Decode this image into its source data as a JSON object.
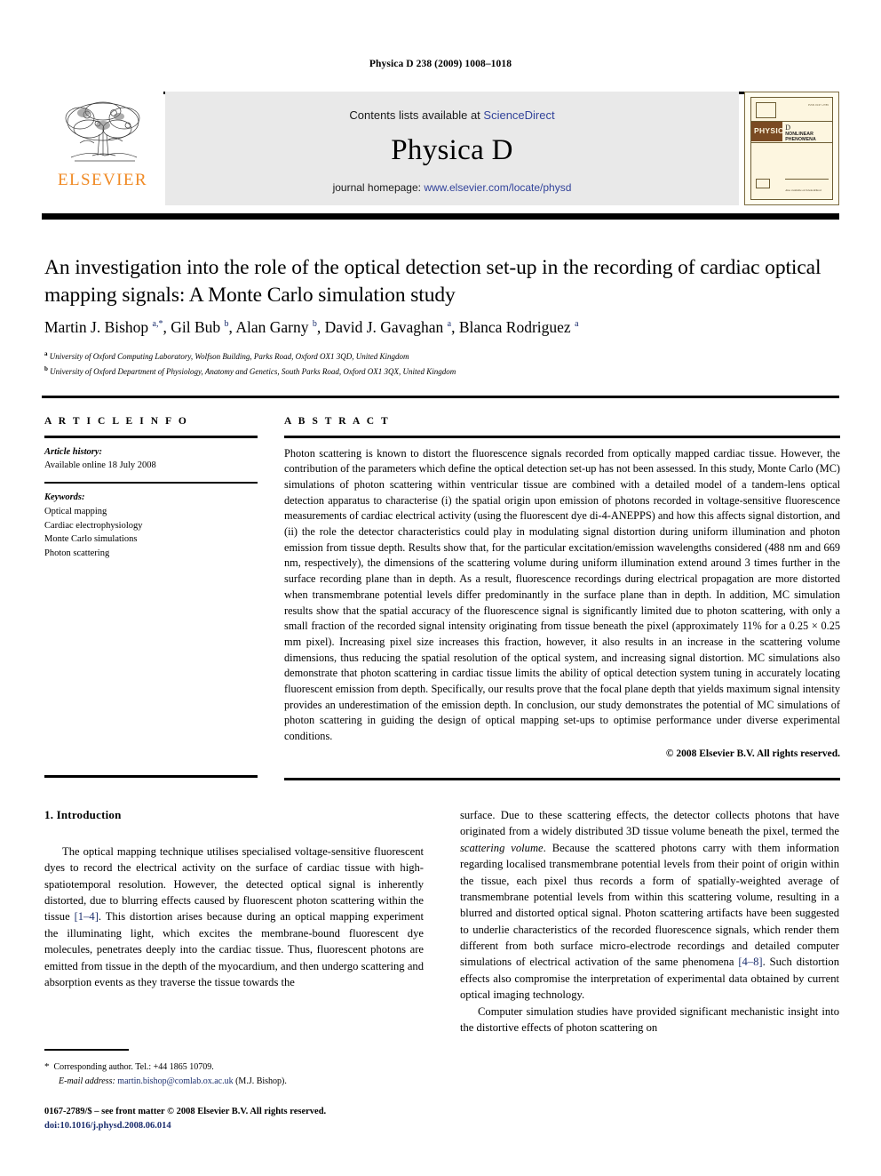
{
  "running_head": "Physica D 238 (2009) 1008–1018",
  "masthead": {
    "publisher_name": "ELSEVIER",
    "contents_prefix": "Contents lists available at ",
    "sciencedirect": "ScienceDirect",
    "journal_name": "Physica D",
    "homepage_prefix": "journal homepage: ",
    "homepage_url": "www.elsevier.com/locate/physd",
    "cover": {
      "band_title": "PHYSICA",
      "volume_letter": "D",
      "subtitle": "NONLINEAR PHENOMENA",
      "top_right": "ISSN 0167-2789",
      "foot_left": "Available online at\nScienceDirect\nwww.sciencedirect.com",
      "foot_right": "Also available on ScienceDirect"
    }
  },
  "article": {
    "title": "An investigation into the role of the optical detection set-up in the recording of cardiac optical mapping signals: A Monte Carlo simulation study",
    "authors_html": "Martin J. Bishop <sup>a,*</sup>, Gil Bub <sup>b</sup>, Alan Garny <sup>b</sup>, David J. Gavaghan <sup>a</sup>, Blanca Rodriguez <sup>a</sup>",
    "affiliation_a": "University of Oxford Computing Laboratory, Wolfson Building, Parks Road, Oxford OX1 3QD, United Kingdom",
    "affiliation_b": "University of Oxford Department of Physiology, Anatomy and Genetics, South Parks Road, Oxford OX1 3QX, United Kingdom"
  },
  "info": {
    "heading": "A R T I C L E   I N F O",
    "history_label": "Article history:",
    "history_value": "Available online 18 July 2008",
    "keywords_label": "Keywords:",
    "keywords": [
      "Optical mapping",
      "Cardiac electrophysiology",
      "Monte Carlo simulations",
      "Photon scattering"
    ]
  },
  "abstract": {
    "heading": "A B S T R A C T",
    "text": "Photon scattering is known to distort the fluorescence signals recorded from optically mapped cardiac tissue. However, the contribution of the parameters which define the optical detection set-up has not been assessed. In this study, Monte Carlo (MC) simulations of photon scattering within ventricular tissue are combined with a detailed model of a tandem-lens optical detection apparatus to characterise (i) the spatial origin upon emission of photons recorded in voltage-sensitive fluorescence measurements of cardiac electrical activity (using the fluorescent dye di-4-ANEPPS) and how this affects signal distortion, and (ii) the role the detector characteristics could play in modulating signal distortion during uniform illumination and photon emission from tissue depth. Results show that, for the particular excitation/emission wavelengths considered (488 nm and 669 nm, respectively), the dimensions of the scattering volume during uniform illumination extend around 3 times further in the surface recording plane than in depth. As a result, fluorescence recordings during electrical propagation are more distorted when transmembrane potential levels differ predominantly in the surface plane than in depth. In addition, MC simulation results show that the spatial accuracy of the fluorescence signal is significantly limited due to photon scattering, with only a small fraction of the recorded signal intensity originating from tissue beneath the pixel (approximately 11% for a 0.25 × 0.25 mm pixel). Increasing pixel size increases this fraction, however, it also results in an increase in the scattering volume dimensions, thus reducing the spatial resolution of the optical system, and increasing signal distortion. MC simulations also demonstrate that photon scattering in cardiac tissue limits the ability of optical detection system tuning in accurately locating fluorescent emission from depth. Specifically, our results prove that the focal plane depth that yields maximum signal intensity provides an underestimation of the emission depth. In conclusion, our study demonstrates the potential of MC simulations of photon scattering in guiding the design of optical mapping set-ups to optimise performance under diverse experimental conditions.",
    "copyright": "© 2008 Elsevier B.V. All rights reserved."
  },
  "body": {
    "section_heading": "1. Introduction",
    "left_para_1": "The optical mapping technique utilises specialised voltage-sensitive fluorescent dyes to record the electrical activity on the surface of cardiac tissue with high-spatiotemporal resolution. However, the detected optical signal is inherently distorted, due to blurring effects caused by fluorescent photon scattering within the tissue ",
    "left_cite_1": "[1–4]",
    "left_para_1_cont": ". This distortion arises because during an optical mapping experiment the illuminating light, which excites the membrane-bound fluorescent dye molecules, penetrates deeply into the cardiac tissue. Thus, fluorescent photons are emitted from tissue in the depth of the myocardium, and then undergo scattering and absorption events as they traverse the tissue towards the",
    "right_para_1_a": "surface. Due to these scattering effects, the detector collects photons that have originated from a widely distributed 3D tissue volume beneath the pixel, termed the ",
    "right_italic_1": "scattering volume",
    "right_para_1_b": ". Because the scattered photons carry with them information regarding localised transmembrane potential levels from their point of origin within the tissue, each pixel thus records a form of spatially-weighted average of transmembrane potential levels from within this scattering volume, resulting in a blurred and distorted optical signal. Photon scattering artifacts have been suggested to underlie characteristics of the recorded fluorescence signals, which render them different from both surface micro-electrode recordings and detailed computer simulations of electrical activation of the same phenomena ",
    "right_cite_1": "[4–8]",
    "right_para_1_c": ". Such distortion effects also compromise the interpretation of experimental data obtained by current optical imaging technology.",
    "right_para_2": "Computer simulation studies have provided significant mechanistic insight into the distortive effects of photon scattering on"
  },
  "footnotes": {
    "corresponding": "Corresponding author. Tel.: +44 1865 10709.",
    "email_label": "E-mail address:",
    "email": "martin.bishop@comlab.ox.ac.uk",
    "email_suffix": " (M.J. Bishop).",
    "imprint": "0167-2789/$ – see front matter © 2008 Elsevier B.V. All rights reserved.",
    "doi": "doi:10.1016/j.physd.2008.06.014"
  },
  "colors": {
    "link": "#33449b",
    "cite": "#1c2f6e",
    "elsevier_orange": "#f08a24",
    "banner_bg": "#e9e9e9",
    "cover_band": "#7a4a22"
  }
}
